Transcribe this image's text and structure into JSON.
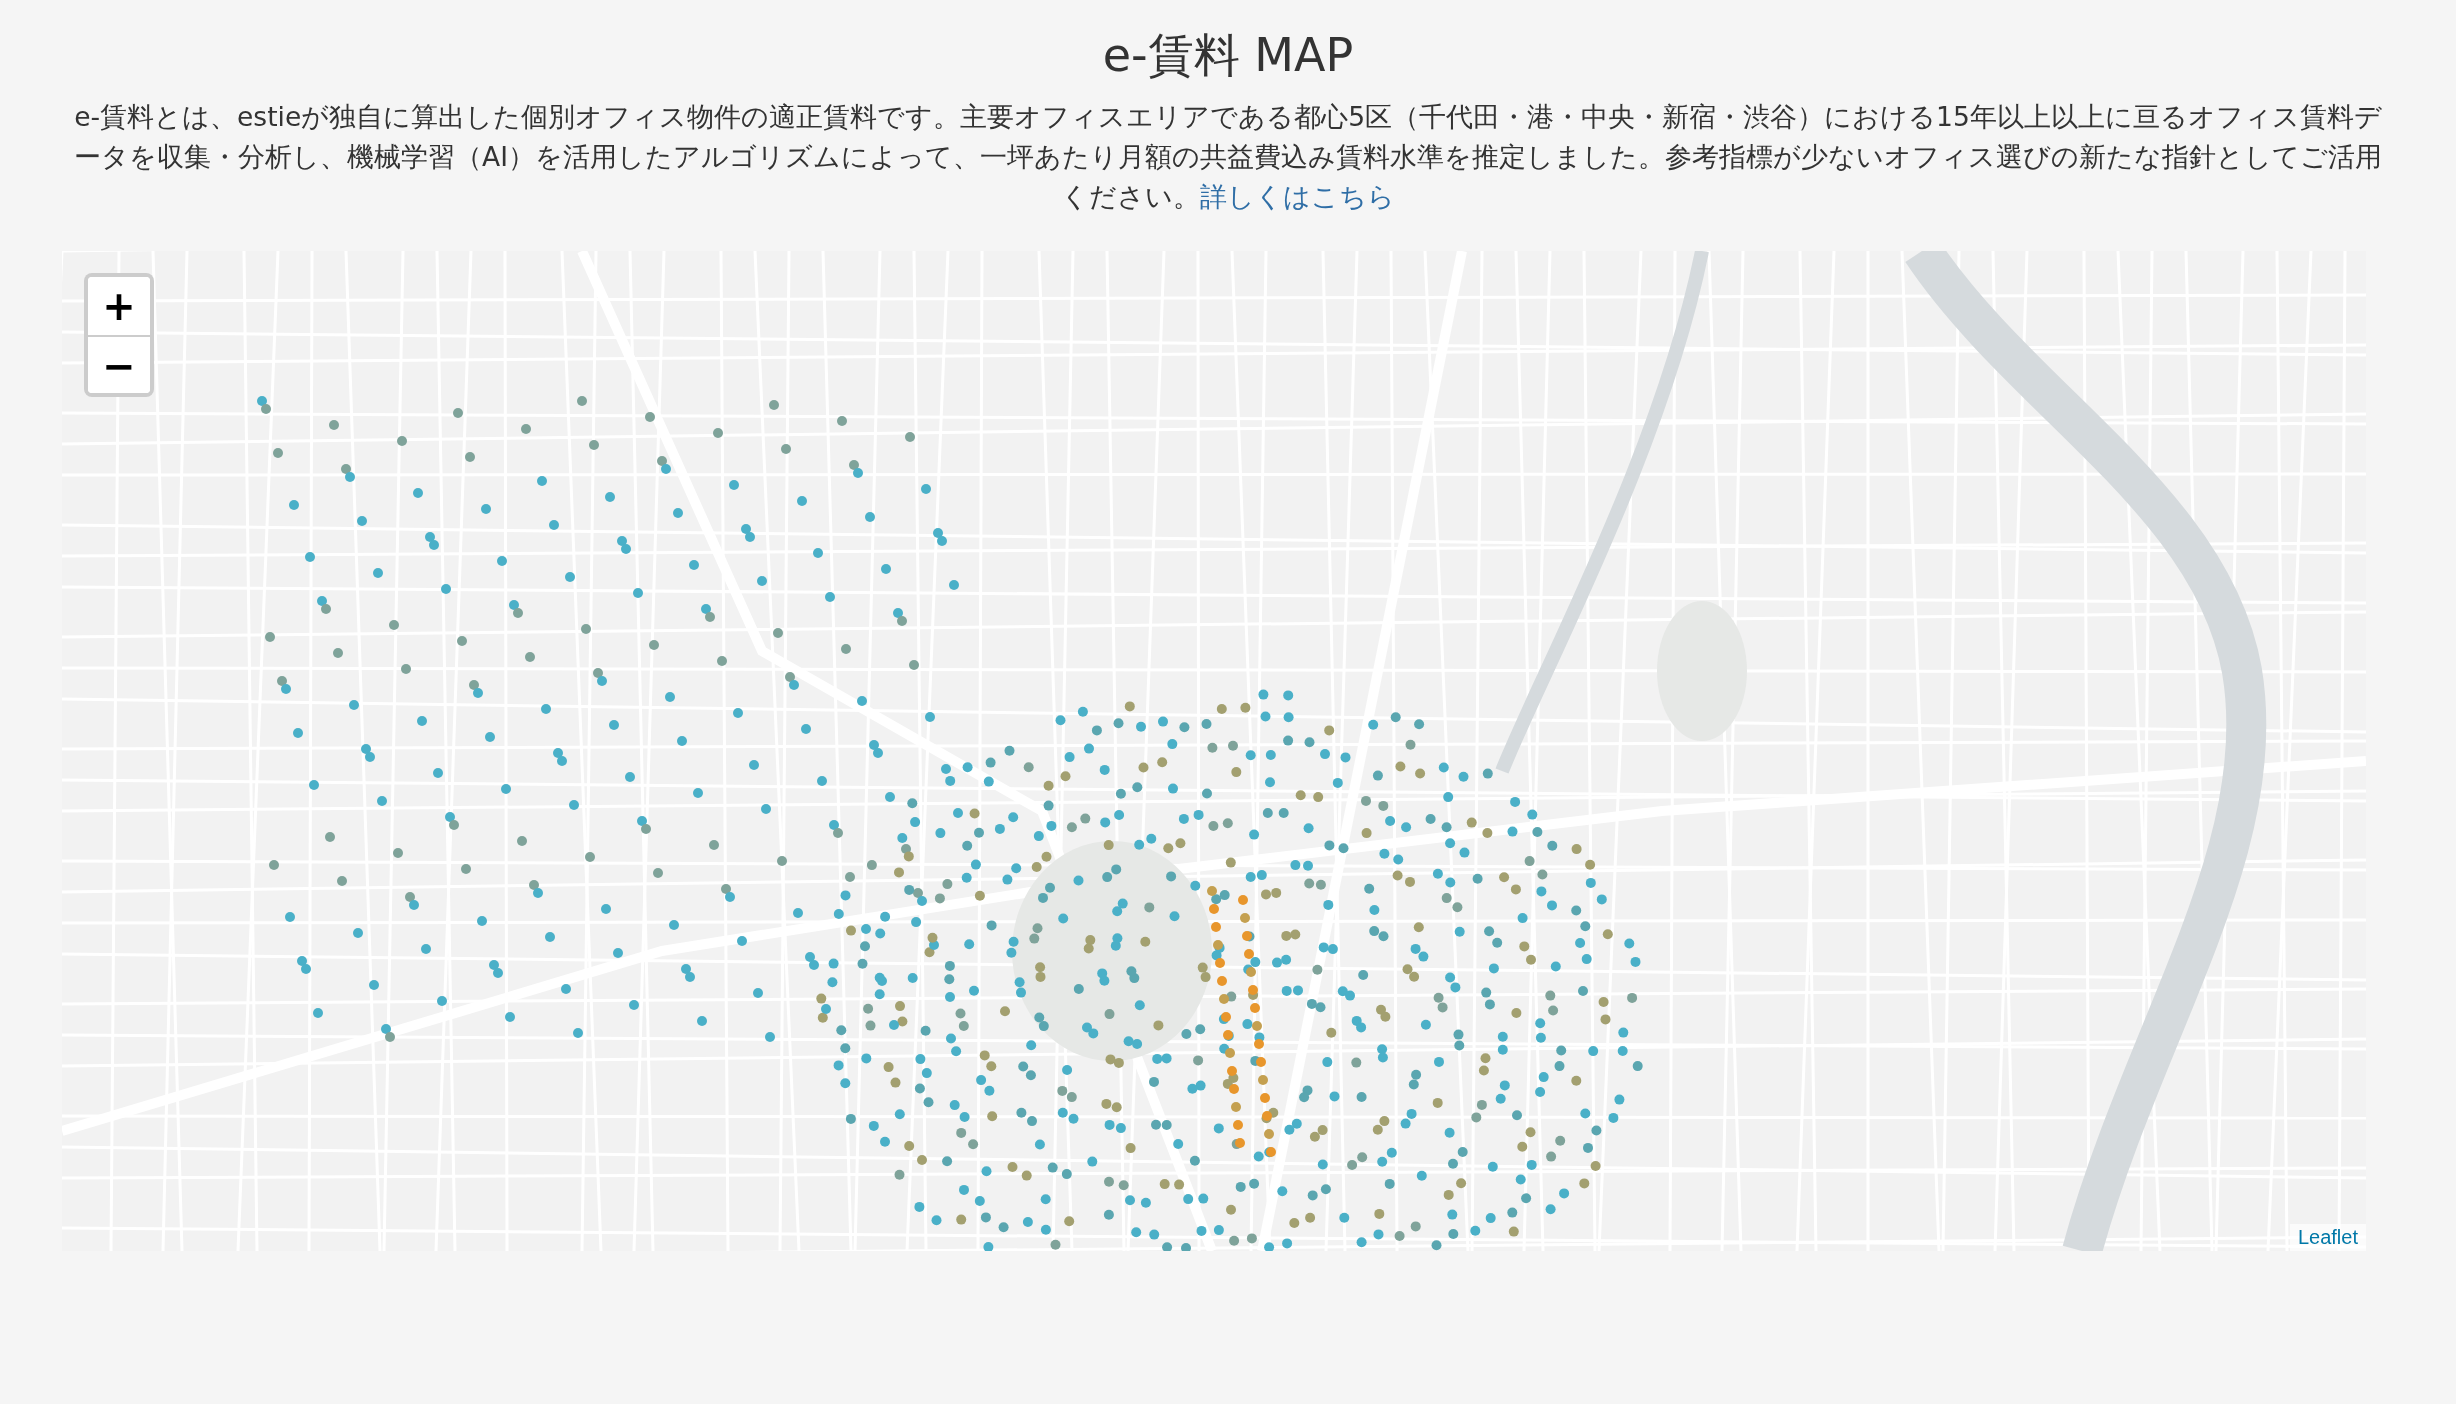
{
  "title": "e-賃料 MAP",
  "intro": {
    "text": "e-賃料とは、estieが独自に算出した個別オフィス物件の適正賃料です。主要オフィスエリアである都心5区（千代田・港・中央・新宿・渋谷）における15年以上以上に亘るオフィス賃料データを収集・分析し、機械学習（AI）を活用したアルゴリズムによって、一坪あたり月額の共益費込み賃料水準を推定しました。参考指標が少ないオフィス選びの新たな指針としてご活用ください。",
    "link": "詳しくはこちら"
  },
  "map": {
    "zoom_in": "+",
    "zoom_out": "−",
    "attribution": "Leaflet"
  }
}
